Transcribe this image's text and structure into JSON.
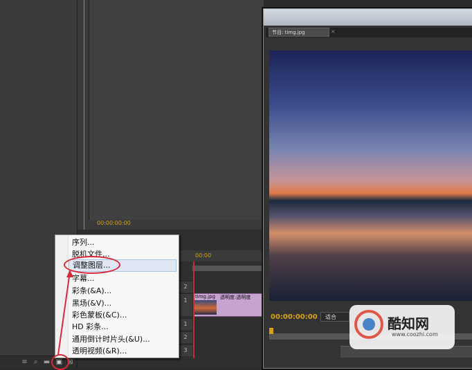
{
  "source_monitor": {
    "timecode": "00:00:00:00"
  },
  "timeline": {
    "timecode": "00:00",
    "tracks": [
      "2",
      "1",
      "1",
      "2",
      "3"
    ]
  },
  "clip": {
    "name": "timg.jpg",
    "opacity_label": "透明度:透明度"
  },
  "program_monitor": {
    "tab_label": "节目: timg.jpg",
    "close_glyph": "×",
    "timecode": "00:00:00:00",
    "fit_label": "适合"
  },
  "context_menu": {
    "items": [
      "序列...",
      "脱机文件...",
      "调整图层...",
      "字幕...",
      "彩条(&A)...",
      "黑场(&V)...",
      "彩色蒙板(&C)...",
      "HD 彩条...",
      "通用倒计时片头(&U)...",
      "透明视频(&R)..."
    ],
    "highlighted_index": 2
  },
  "watermark": {
    "title": "酷知网",
    "url": "www.coozhi.com"
  },
  "colors": {
    "accent_time": "#d6a21a",
    "annotation": "#d8283a"
  }
}
